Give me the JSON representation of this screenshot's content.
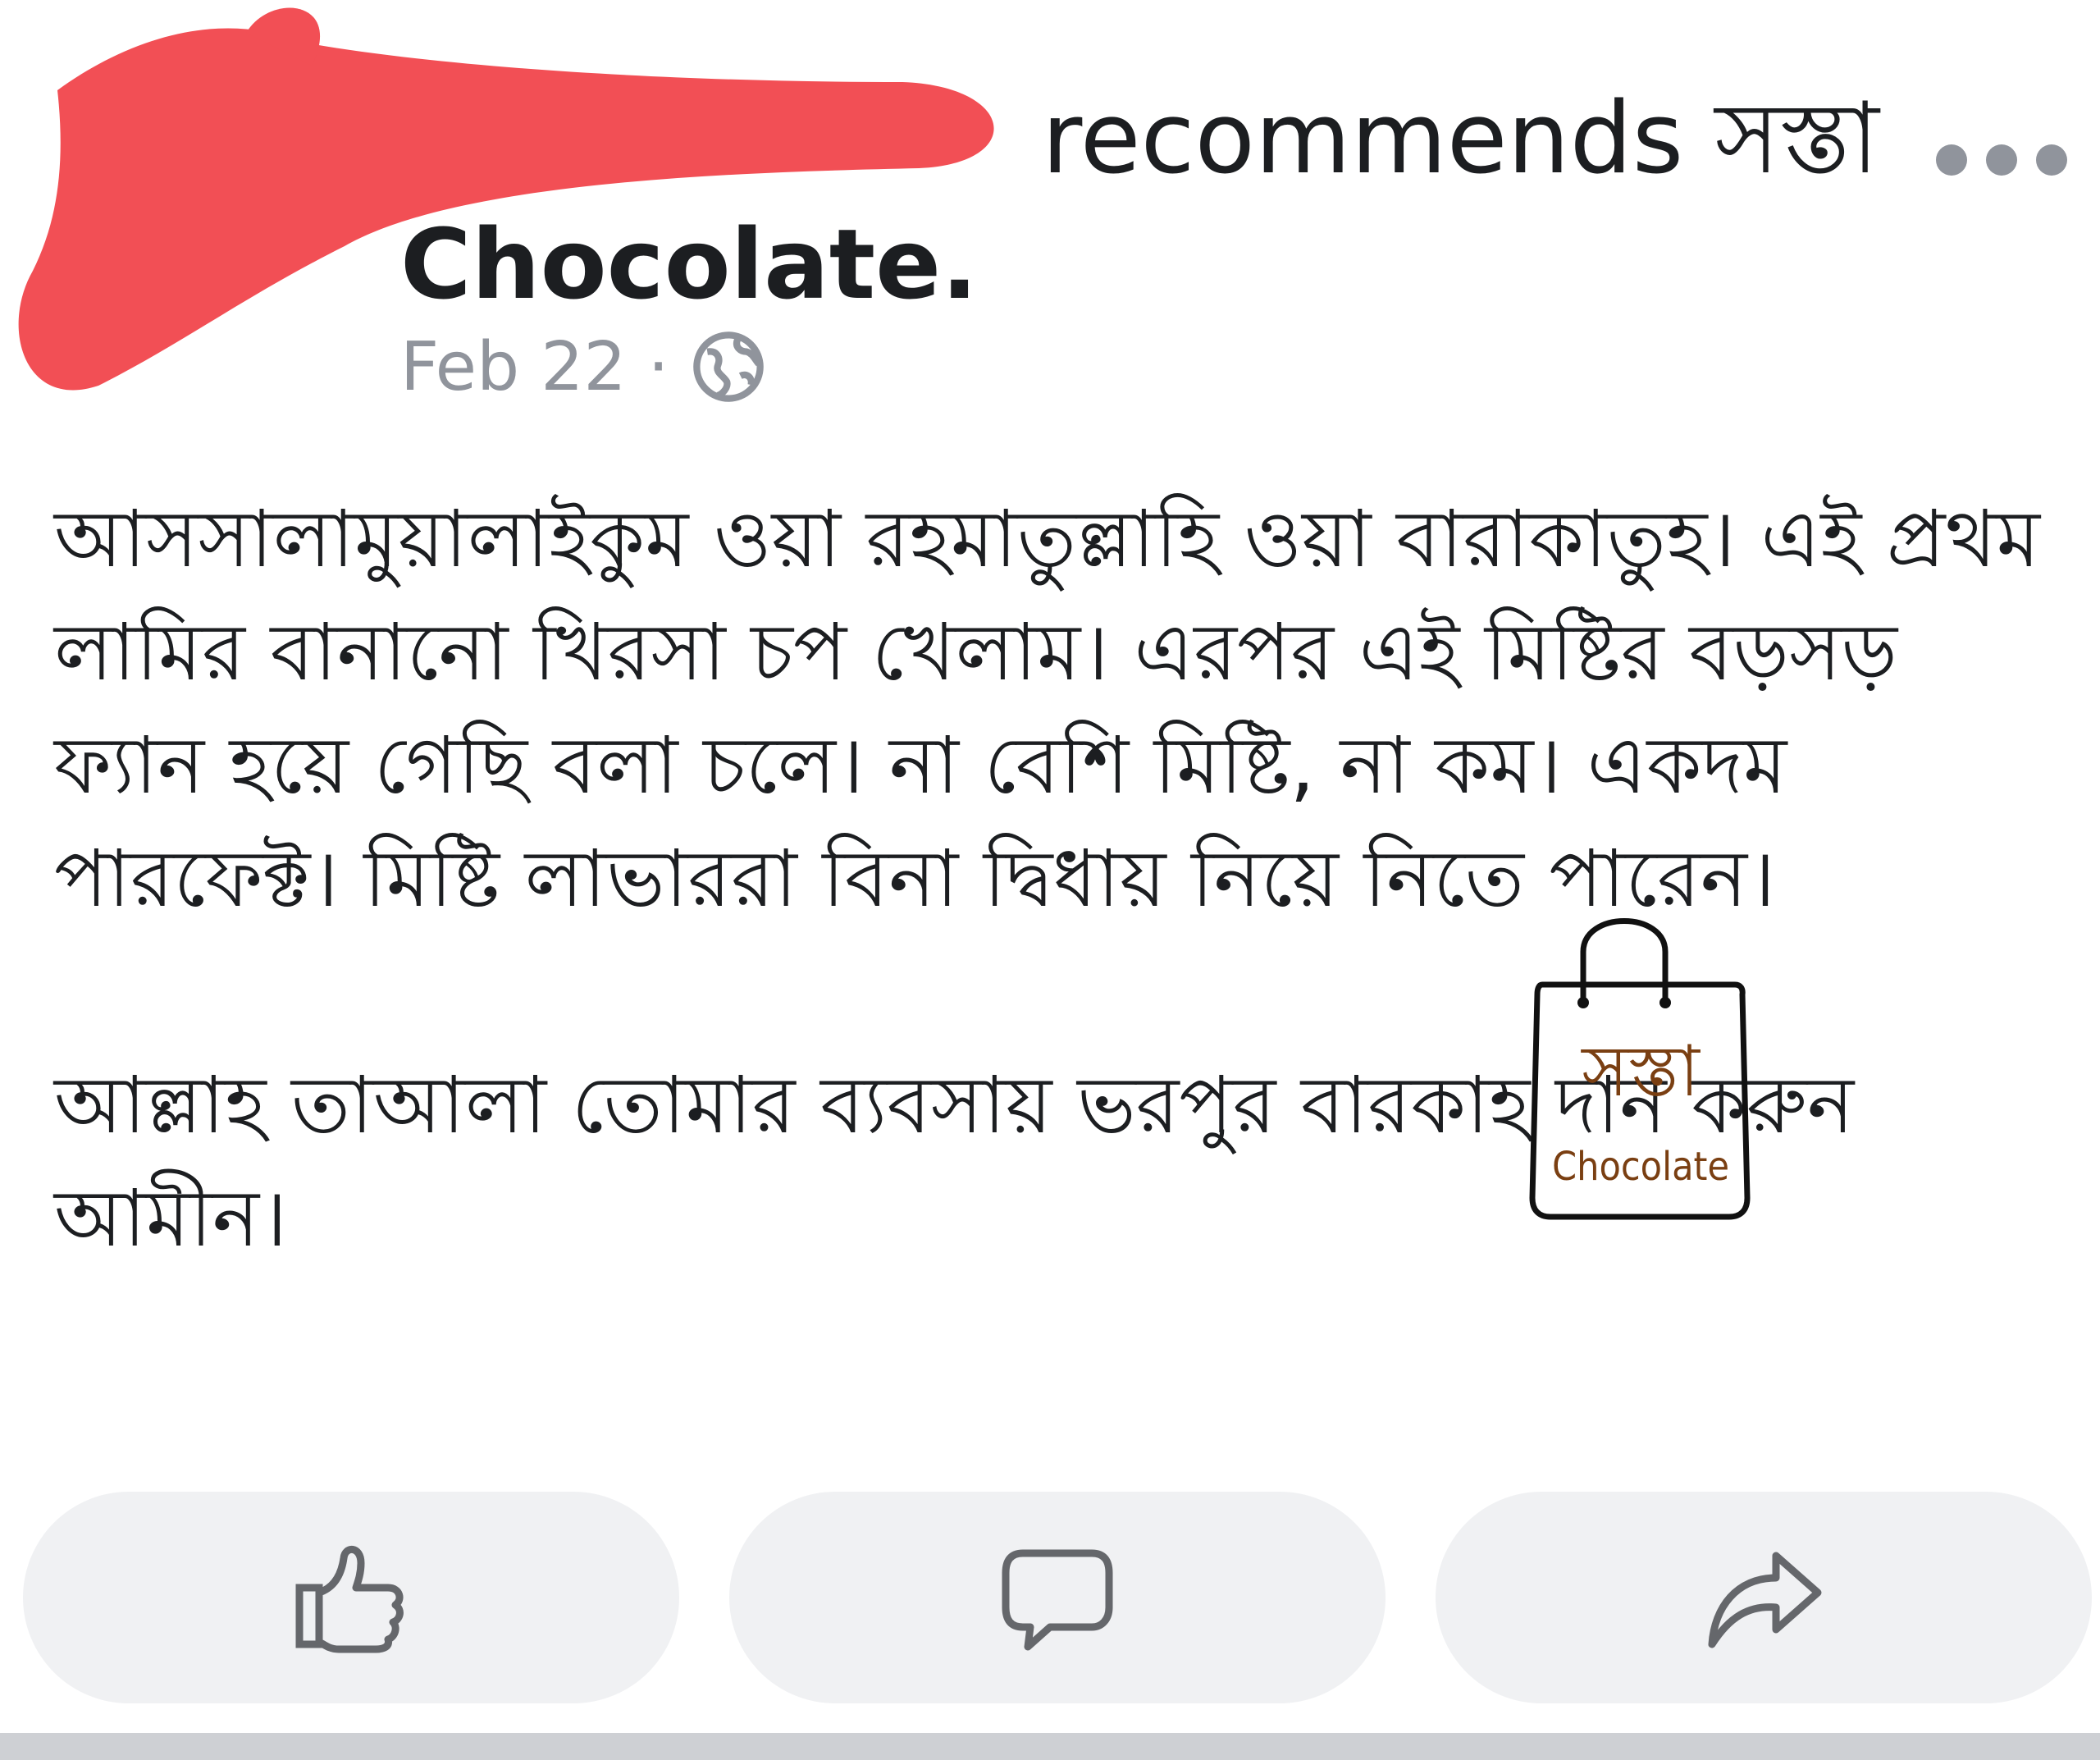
{
  "post": {
    "header": {
      "action_text": "recommends সস্তা",
      "page_name": "Chocolate.",
      "date": "Feb 22",
      "separator": "·",
      "privacy_icon": "globe-icon",
      "more_icon": "more-options-icon"
    },
    "body": {
      "paragraph_1": "আসসালামুয়ালাইকুম ওয়া রহমাতুল্লাহি ওয়া বারাকাতুহ। এই প্রথম লামির বানানো খিরসা চপ খেলাম। এরপর এই মিষ্টির বড়সড় ফ্যান হয়ে গেছি বলা চলে। না বেশি মিষ্টি, না কম। একদম পারফেক্ট। মিষ্টি লাভাররা বিনা দ্বিধায় নিয়ে নিতে পারেন।",
      "paragraph_2": "আল্লাহ তাআলা তোমার ব্যবসায় ভরপুর বারকাহ দান করুন আমীন।"
    },
    "logo": {
      "title": "সস্তা",
      "subtitle": "Chocolate",
      "color": "#7a3f12"
    },
    "actions": [
      {
        "name": "like",
        "icon": "thumbs-up-icon"
      },
      {
        "name": "comment",
        "icon": "comment-icon"
      },
      {
        "name": "share",
        "icon": "share-arrow-icon"
      }
    ],
    "colors": {
      "text": "#1c1e21",
      "meta": "#90949c",
      "redaction": "#f24f55",
      "button_bg": "#f0f1f3",
      "icon": "#65676b"
    }
  }
}
